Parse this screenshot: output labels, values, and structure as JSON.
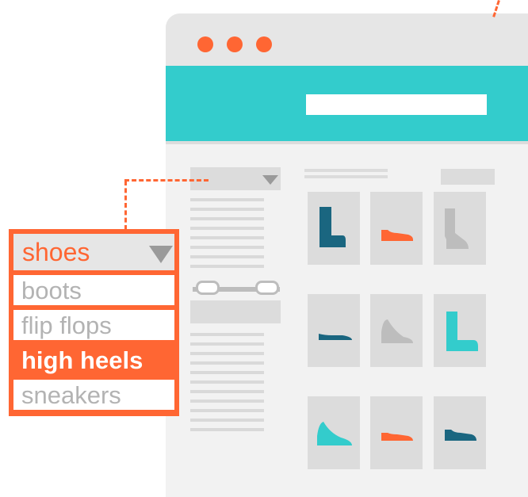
{
  "colors": {
    "accent": "#ff6633",
    "header": "#33cccc",
    "navy": "#1a6680",
    "placeholder": "#dcdcdc"
  },
  "window": {
    "controls": [
      "close-dot",
      "minimize-dot",
      "maximize-dot"
    ]
  },
  "dropdown": {
    "selected": "shoes",
    "caret_icon": "caret-down-icon",
    "options": [
      "boots",
      "flip flops",
      "high heels",
      "sneakers"
    ],
    "highlighted": "high heels"
  },
  "products": [
    {
      "icon": "boot-icon",
      "color": "#1a6680"
    },
    {
      "icon": "sneaker-icon",
      "color": "#ff6633"
    },
    {
      "icon": "boot-icon",
      "color": "#bdbdbd"
    },
    {
      "icon": "flat-shoe-icon",
      "color": "#1a6680"
    },
    {
      "icon": "high-heel-icon",
      "color": "#bdbdbd"
    },
    {
      "icon": "boot-icon",
      "color": "#33cccc"
    },
    {
      "icon": "high-heel-icon",
      "color": "#33cccc"
    },
    {
      "icon": "sneaker-icon",
      "color": "#ff6633"
    },
    {
      "icon": "sneaker-icon",
      "color": "#1a6680"
    }
  ]
}
